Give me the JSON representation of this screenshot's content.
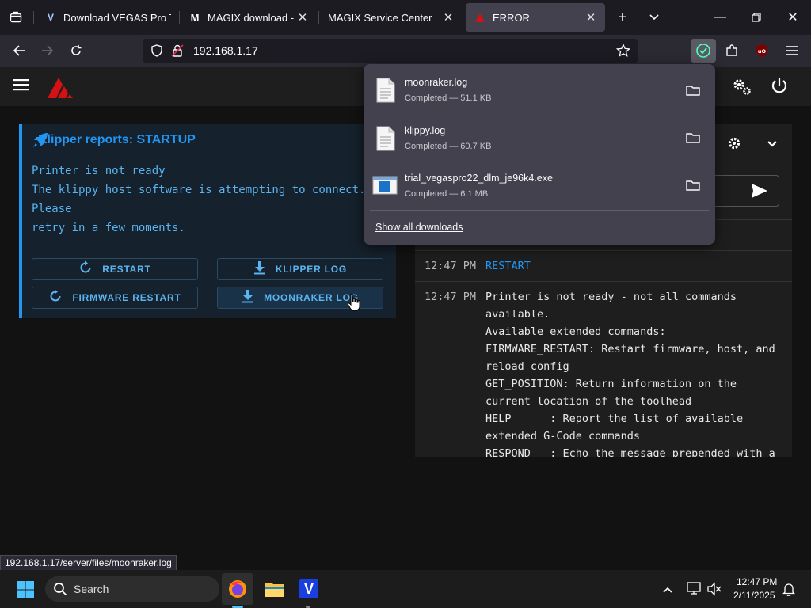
{
  "browser": {
    "tabs": [
      {
        "title": "Download VEGAS Pro T",
        "favicon": "vegas-v",
        "active": false
      },
      {
        "title": "MAGIX download - tha",
        "favicon": "magix-m",
        "active": false
      },
      {
        "title": "MAGIX Service Center",
        "favicon": "none",
        "active": false
      },
      {
        "title": "ERROR",
        "favicon": "mainsail-logo",
        "active": true
      }
    ],
    "url": "192.168.1.17"
  },
  "downloads": {
    "items": [
      {
        "name": "moonraker.log",
        "status": "Completed — 51.1 KB",
        "icon": "document-icon"
      },
      {
        "name": "klippy.log",
        "status": "Completed — 60.7 KB",
        "icon": "document-icon"
      },
      {
        "name": "trial_vegaspro22_dlm_je96k4.exe",
        "status": "Completed — 6.1 MB",
        "icon": "exe-icon"
      }
    ],
    "show_all": "Show all downloads"
  },
  "startup": {
    "title": "Klipper reports: STARTUP",
    "lines": [
      "Printer is not ready",
      "The klippy host software is attempting to connect.",
      "Please",
      "retry in a few moments."
    ],
    "buttons": {
      "restart": "RESTART",
      "klipper_log": "KLIPPER LOG",
      "firmware_restart": "FIRMWARE RESTART",
      "moonraker_log": "MOONRAKER LOG"
    }
  },
  "console": {
    "entries": [
      {
        "time": "12:47 PM",
        "text": "RESTART",
        "command": true
      },
      {
        "time": "12:47 PM",
        "lines": [
          "Printer is not ready - not all commands",
          "available.",
          "Available extended commands:",
          "FIRMWARE_RESTART: Restart firmware, host, and",
          "reload config",
          "GET_POSITION: Return information on the",
          "current location of the toolhead",
          "HELP      : Report the list of available",
          "extended G-Code commands",
          "RESPOND   : Echo the message prepended with a"
        ]
      }
    ]
  },
  "status_tip": "192.168.1.17/server/files/moonraker.log",
  "taskbar": {
    "search_placeholder": "Search",
    "time": "12:47 PM",
    "date": "2/11/2025"
  },
  "colors": {
    "accent": "#2196f3",
    "brand_red": "#d41216",
    "console_cmd": "#2196f3"
  }
}
